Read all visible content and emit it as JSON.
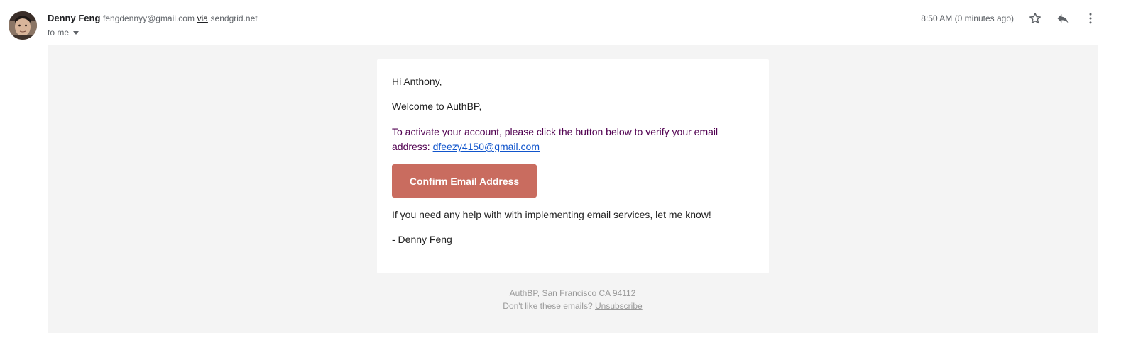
{
  "sender": {
    "name": "Denny Feng",
    "email": "fengdennyy@gmail.com",
    "via_label": "via",
    "via_host": "sendgrid.net",
    "recipient_label": "to me"
  },
  "header": {
    "timestamp": "8:50 AM (0 minutes ago)",
    "icons": [
      "star-icon",
      "reply-icon",
      "more-vert-icon"
    ]
  },
  "email": {
    "greeting": "Hi Anthony,",
    "welcome": "Welcome to AuthBP,",
    "activate_text": "To activate your account, please click the button below to verify your email address: ",
    "activate_link": "dfeezy4150@gmail.com",
    "button_label": "Confirm Email Address",
    "help_text": "If you need any help with with implementing email services, let me know!",
    "signature": "- Denny Feng"
  },
  "footer": {
    "address": "AuthBP, San Francisco CA 94112",
    "unsub_prompt": "Don't like these emails? ",
    "unsub_link": "Unsubscribe"
  },
  "colors": {
    "button": "#c96c5f",
    "link": "#1155cc",
    "activate_text": "#500050",
    "canvas": "#f4f4f4"
  }
}
